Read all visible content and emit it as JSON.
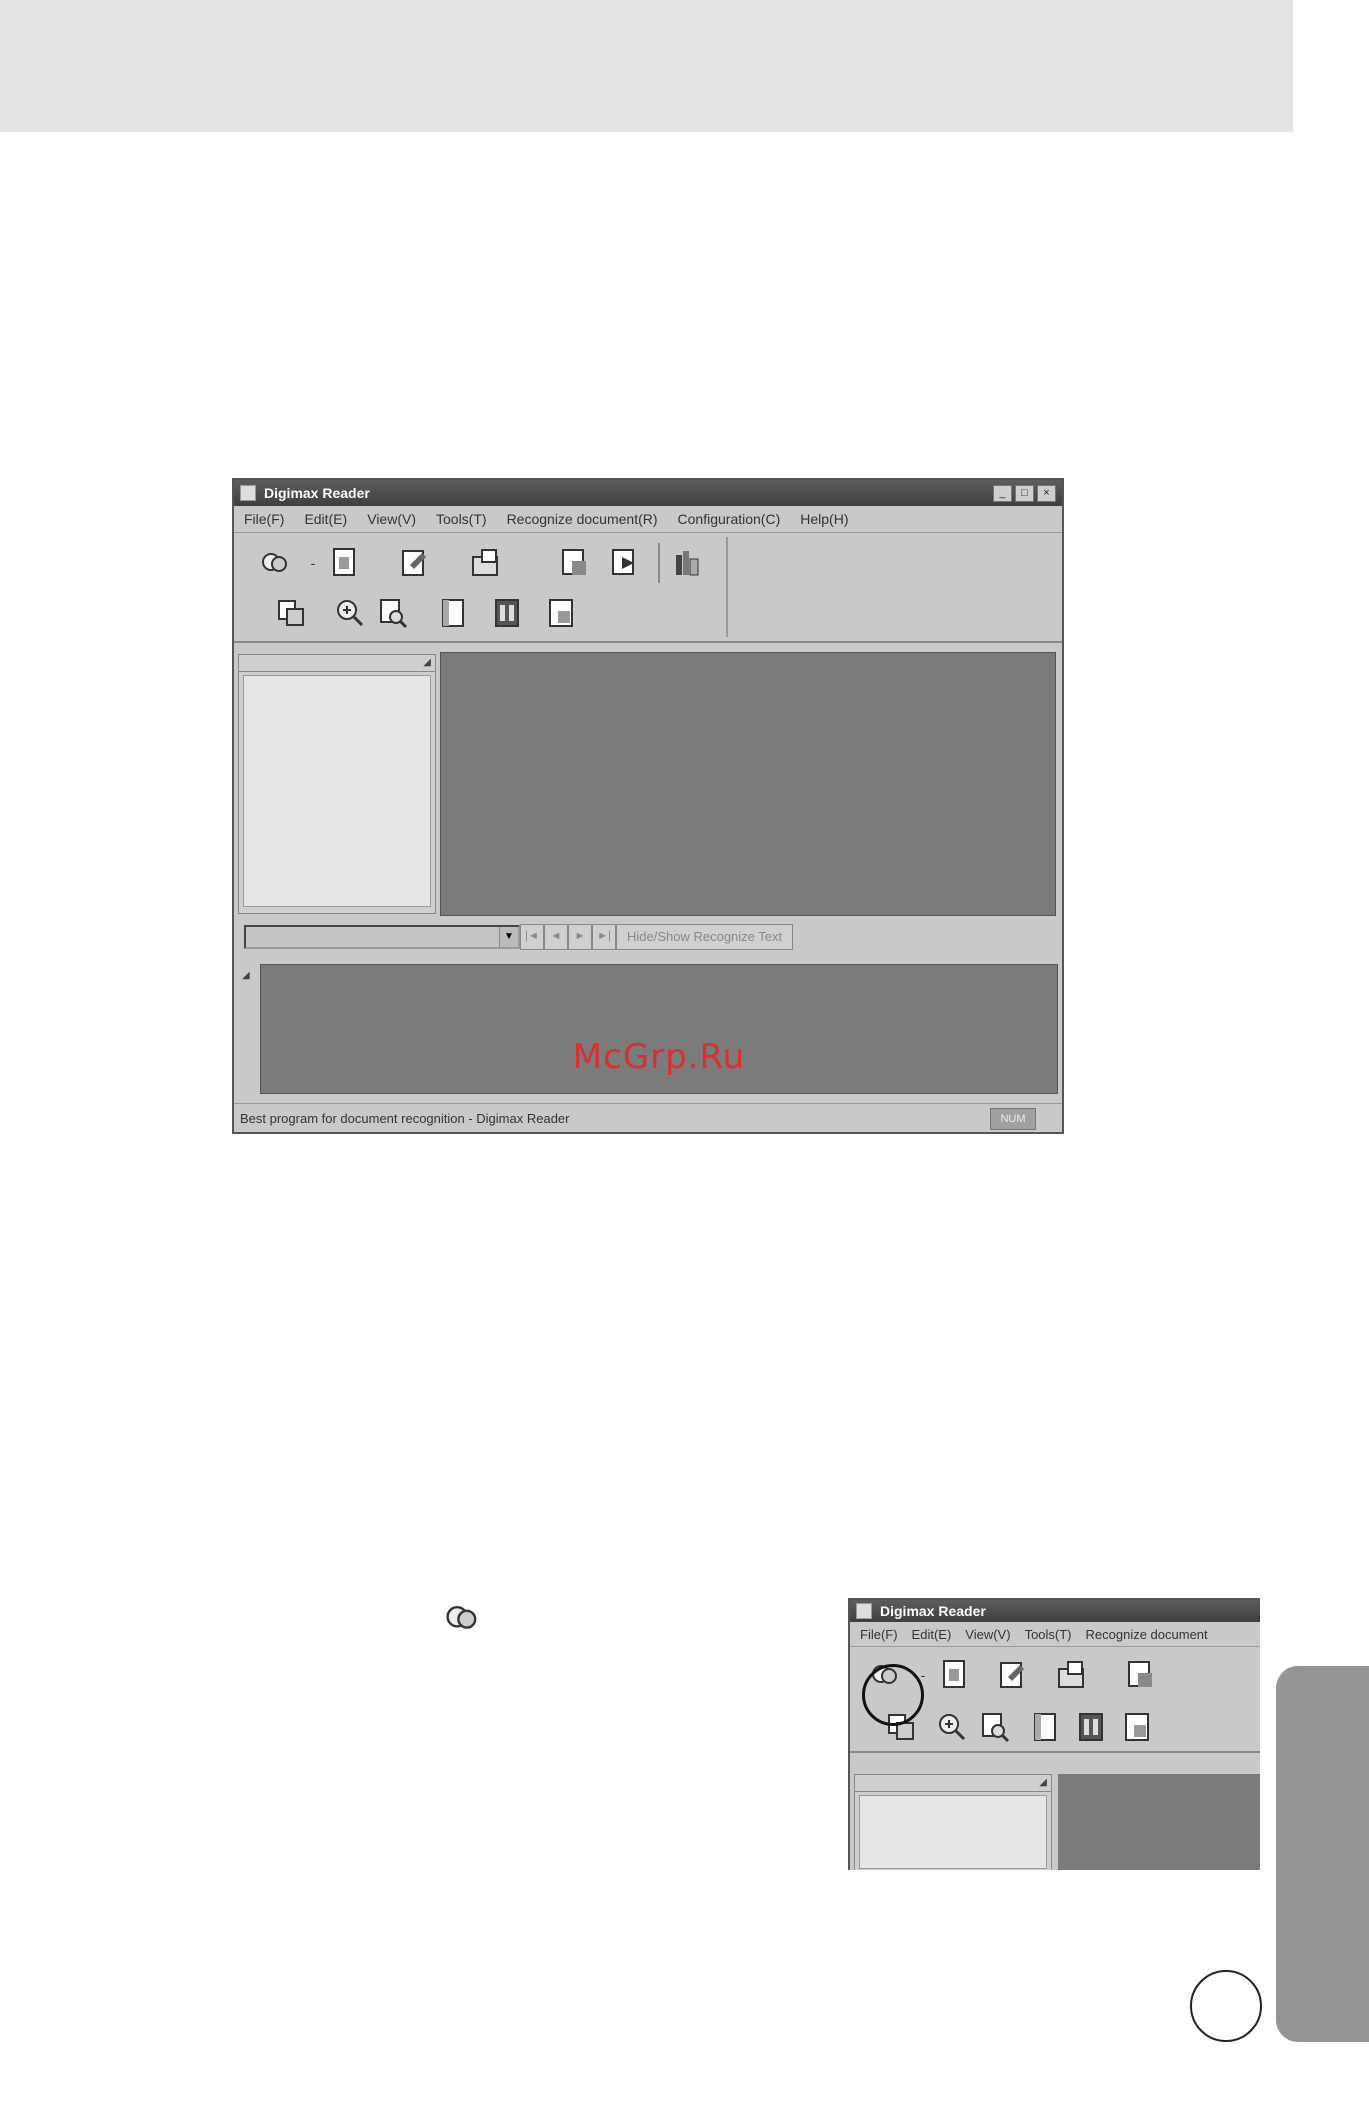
{
  "app": {
    "title": "Digimax Reader",
    "window_buttons": [
      "_",
      "□",
      "×"
    ],
    "menu": [
      "File(F)",
      "Edit(E)",
      "View(V)",
      "Tools(T)",
      "Recognize document(R)",
      "Configuration(C)",
      "Help(H)"
    ],
    "toolbar_row1": [
      "scan-icon",
      "open-document-icon",
      "edit-document-icon",
      "folder-icon",
      "recognize-icon",
      "export-icon",
      "book-icon"
    ],
    "toolbar_row2": [
      "copy-icon",
      "zoom-in-icon",
      "zoom-fit-icon",
      "page-icon",
      "columns-icon",
      "save-icon"
    ],
    "nav_buttons": [
      "|◄",
      "◄",
      "►",
      "►|"
    ],
    "hide_label": "Hide/Show Recognize Text",
    "status_text": "Best program for document recognition - Digimax Reader",
    "status_box": "NUM"
  },
  "crop": {
    "title": "Digimax Reader",
    "menu": [
      "File(F)",
      "Edit(E)",
      "View(V)",
      "Tools(T)",
      "Recognize document"
    ]
  },
  "watermark": "McGrp.Ru",
  "colors": {
    "band": "#e3e3e3",
    "side_tab": "#959595",
    "workspace": "#7b7b7b",
    "watermark": "#d83030"
  }
}
